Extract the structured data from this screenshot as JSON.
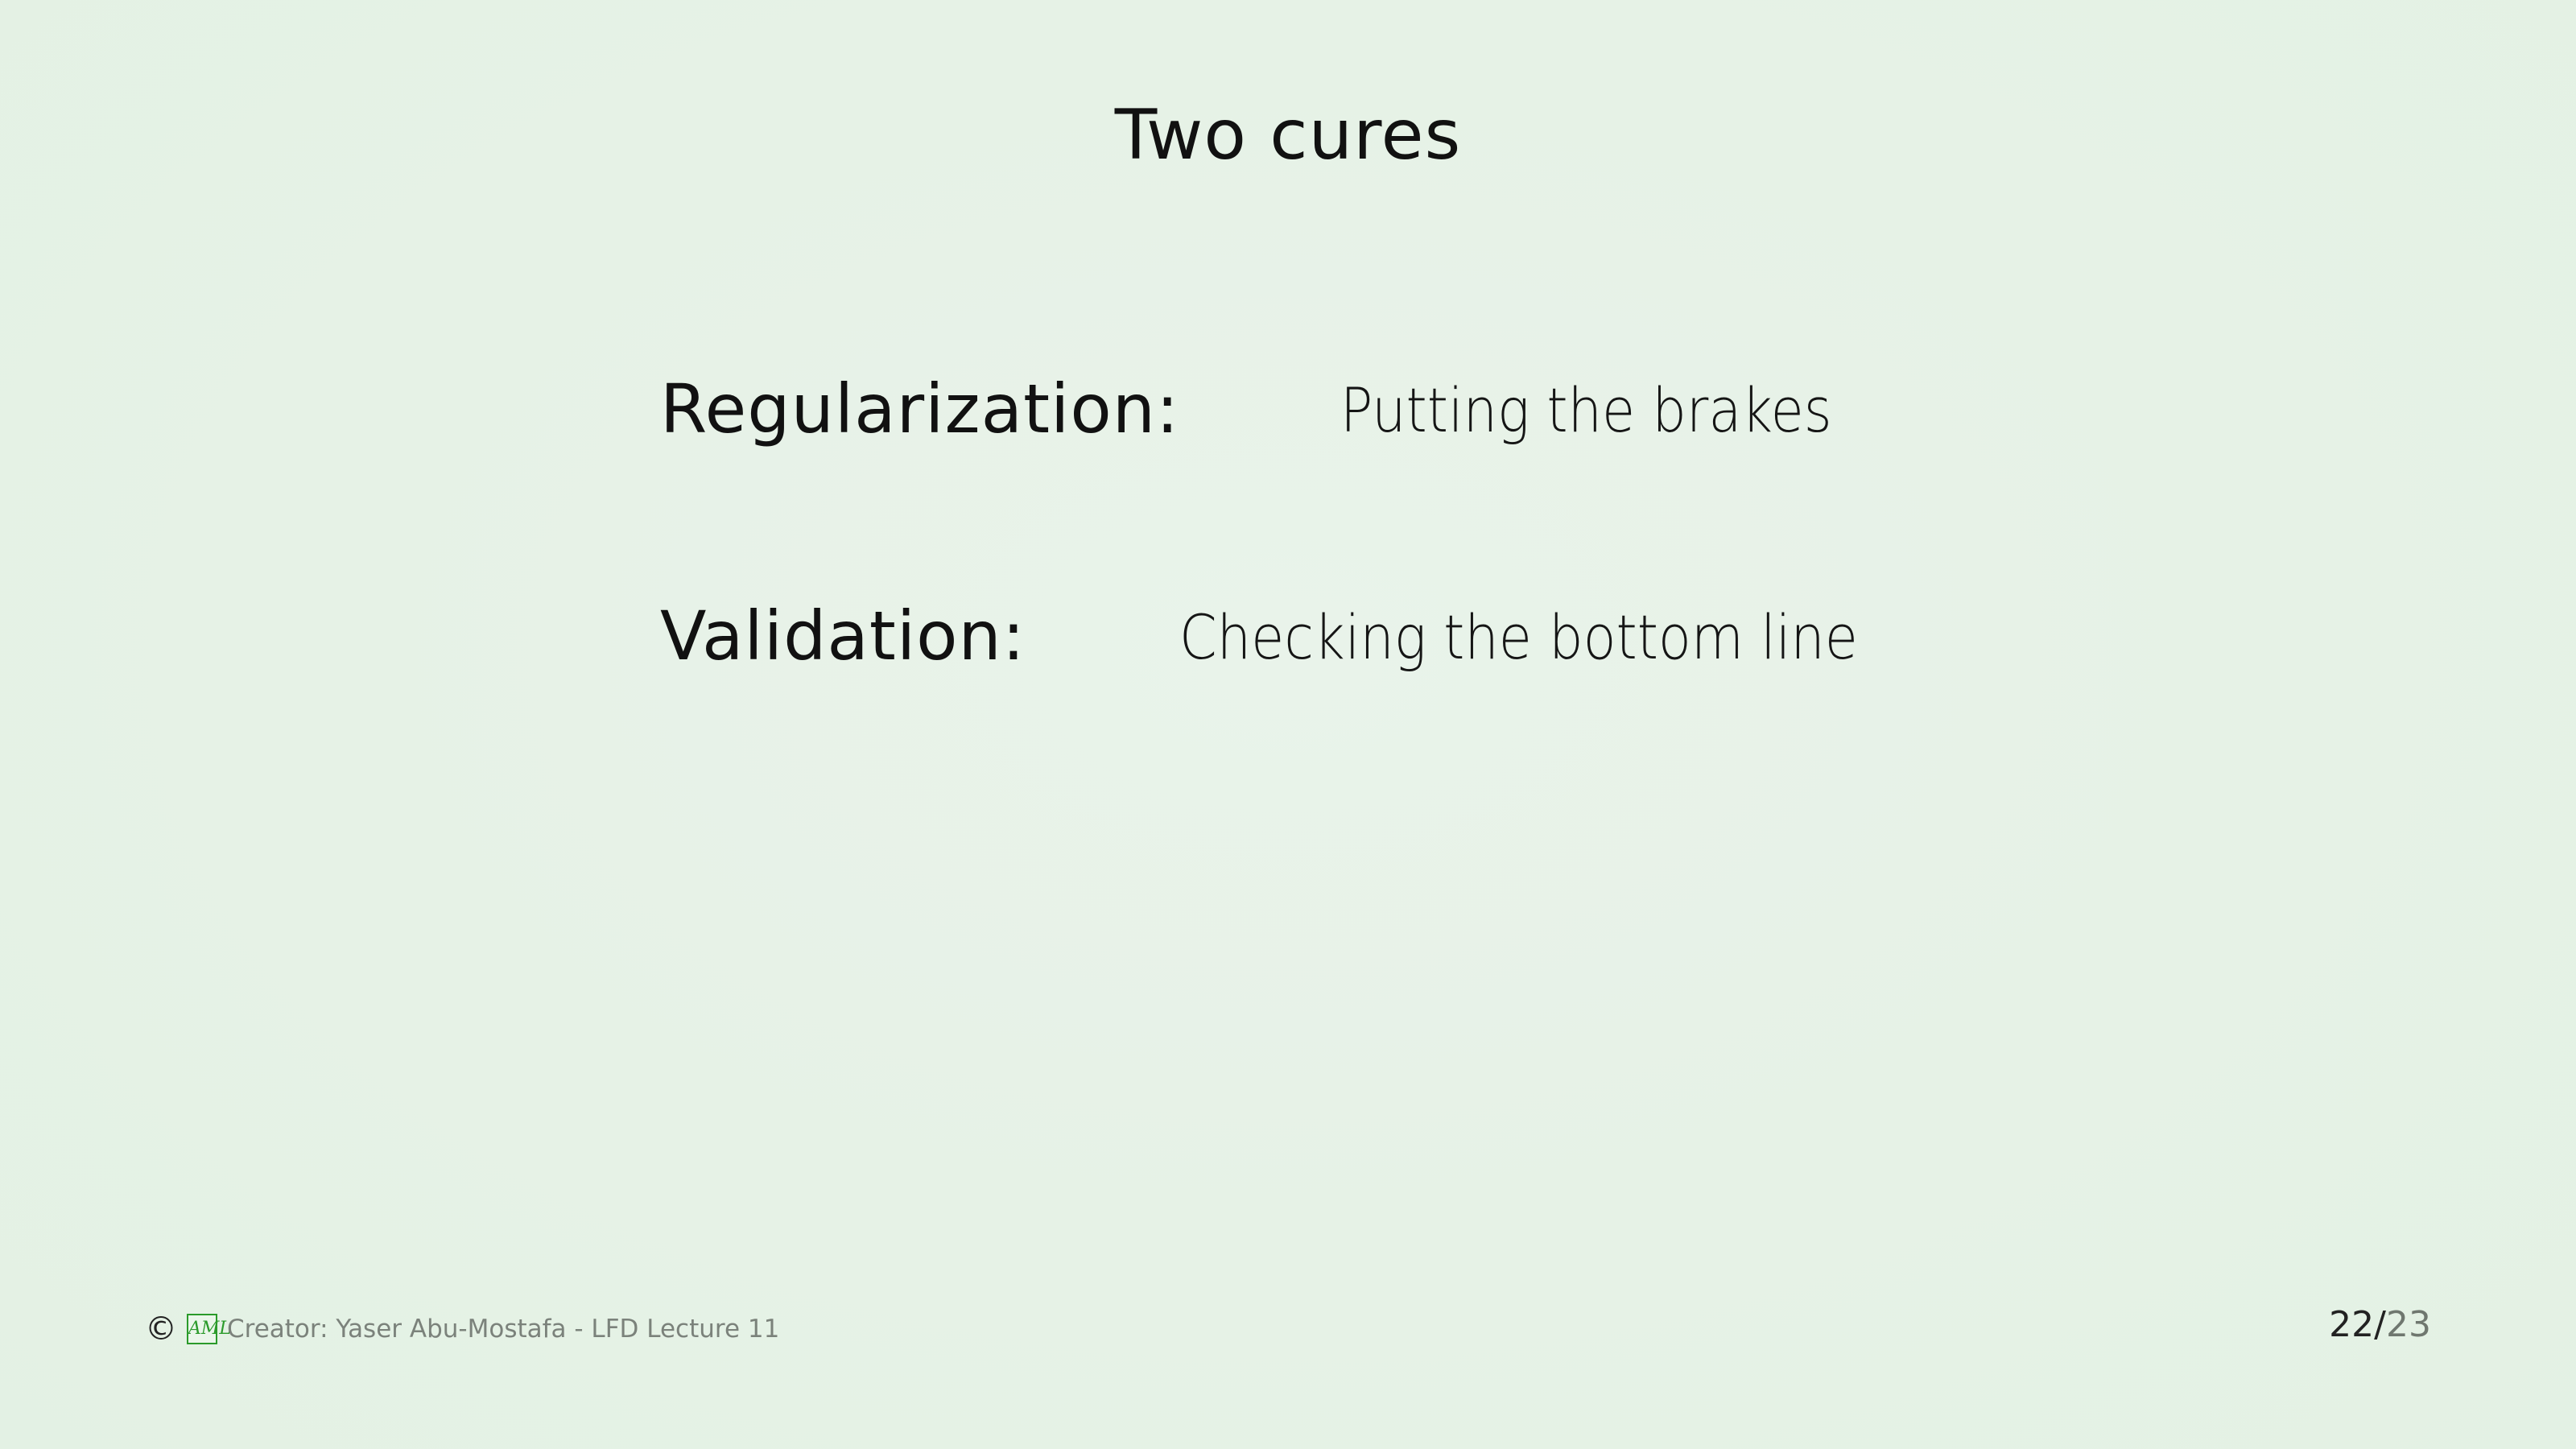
{
  "slide": {
    "title": "Two cures",
    "items": [
      {
        "term": "Regularization:",
        "description": "Putting the brakes"
      },
      {
        "term": "Validation:",
        "description": "Checking the bottom line"
      }
    ]
  },
  "footer": {
    "copyright_symbol": "©",
    "logo_text": "AML",
    "credit": "Creator: Yaser Abu-Mostafa - LFD Lecture 11"
  },
  "page": {
    "current": "22",
    "separator": "/",
    "total": "23"
  }
}
